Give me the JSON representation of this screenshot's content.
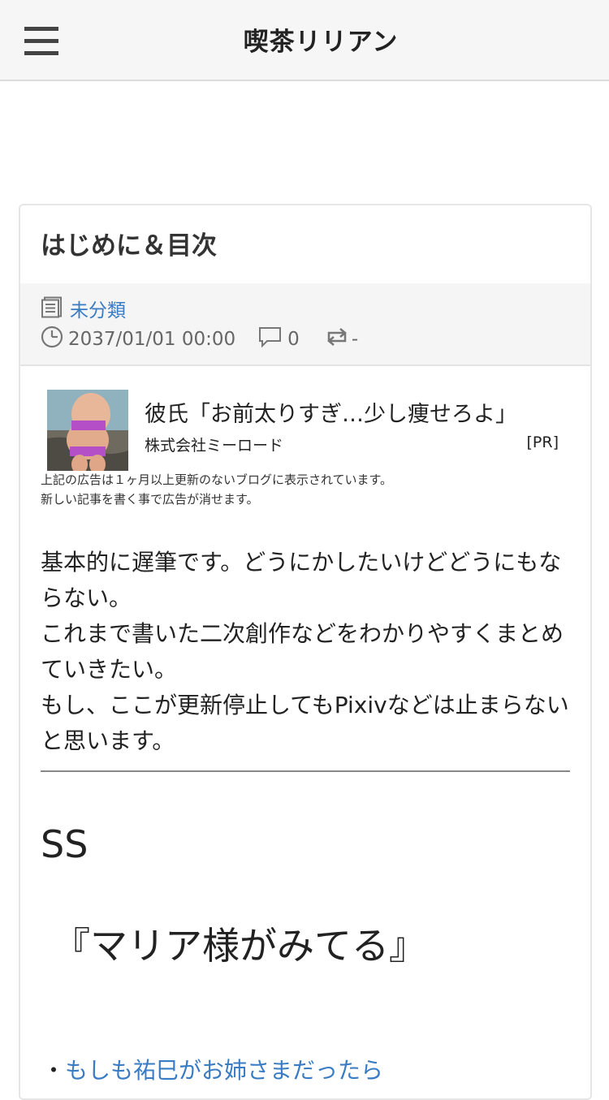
{
  "header": {
    "site_title": "喫茶リリアン",
    "menu_icon": "hamburger-menu-icon"
  },
  "post": {
    "title": "はじめに＆目次",
    "meta": {
      "category": "未分類",
      "datetime": "2037/01/01 00:00",
      "comment_count": "0",
      "trackback": "-",
      "icons": [
        "document-icon",
        "clock-icon",
        "comment-icon",
        "trackback-icon"
      ]
    },
    "ad": {
      "title": "彼氏「お前太りすぎ…少し痩せろよ」",
      "sponsor": "株式会社ミーロード",
      "pr_label": "[PR]",
      "note_line1": "上記の広告は１ヶ月以上更新のないブログに表示されています。",
      "note_line2": "新しい記事を書く事で広告が消せます。"
    },
    "body_lines": [
      "基本的に遅筆です。どうにかしたいけどどうにもならない。",
      "これまで書いた二次創作などをわかりやすくまとめていきたい。",
      "もし、ここが更新停止してもPixivなどは止まらないと思います。"
    ],
    "section_heading": "SS",
    "subheading": "『マリア様がみてる』",
    "list": [
      {
        "bullet": "・",
        "label": "もしも祐巳がお姉さまだったら"
      }
    ]
  },
  "colors": {
    "link": "#3a7cc4",
    "header_bg": "#f6f6f6",
    "meta_bg": "#f5f5f5"
  }
}
